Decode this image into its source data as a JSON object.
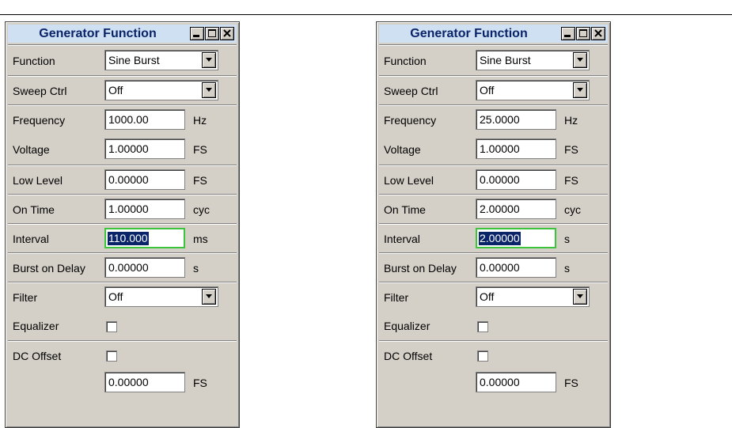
{
  "panels": [
    {
      "title": "Generator Function",
      "function": {
        "label": "Function",
        "value": "Sine Burst"
      },
      "sweep_ctrl": {
        "label": "Sweep Ctrl",
        "value": "Off"
      },
      "frequency": {
        "label": "Frequency",
        "value": "1000.00",
        "unit": "Hz"
      },
      "voltage": {
        "label": "Voltage",
        "value": "1.00000",
        "unit": "FS"
      },
      "low_level": {
        "label": "Low Level",
        "value": "0.00000",
        "unit": "FS"
      },
      "on_time": {
        "label": "On Time",
        "value": "1.00000",
        "unit": "cyc"
      },
      "interval": {
        "label": "Interval",
        "value": "110.000",
        "unit": "ms"
      },
      "burst_on_delay": {
        "label": "Burst on Delay",
        "value": "0.00000",
        "unit": "s"
      },
      "filter": {
        "label": "Filter",
        "value": "Off"
      },
      "equalizer": {
        "label": "Equalizer",
        "checked": false
      },
      "dc_offset": {
        "label": "DC Offset",
        "checked": false,
        "value": "0.00000",
        "unit": "FS"
      }
    },
    {
      "title": "Generator Function",
      "function": {
        "label": "Function",
        "value": "Sine Burst"
      },
      "sweep_ctrl": {
        "label": "Sweep Ctrl",
        "value": "Off"
      },
      "frequency": {
        "label": "Frequency",
        "value": "25.0000",
        "unit": "Hz"
      },
      "voltage": {
        "label": "Voltage",
        "value": "1.00000",
        "unit": "FS"
      },
      "low_level": {
        "label": "Low Level",
        "value": "0.00000",
        "unit": "FS"
      },
      "on_time": {
        "label": "On Time",
        "value": "2.00000",
        "unit": "cyc"
      },
      "interval": {
        "label": "Interval",
        "value": "2.00000",
        "unit": "s"
      },
      "burst_on_delay": {
        "label": "Burst on Delay",
        "value": "0.00000",
        "unit": "s"
      },
      "filter": {
        "label": "Filter",
        "value": "Off"
      },
      "equalizer": {
        "label": "Equalizer",
        "checked": false
      },
      "dc_offset": {
        "label": "DC Offset",
        "checked": false,
        "value": "0.00000",
        "unit": "FS"
      }
    }
  ],
  "icons": {
    "minimize": "minimize-icon",
    "maximize": "maximize-icon",
    "close": "close-icon",
    "dropdown": "chevron-down-icon"
  }
}
